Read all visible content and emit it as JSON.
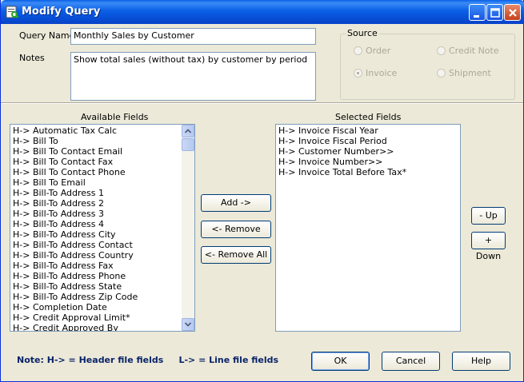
{
  "window": {
    "title": "Modify Query"
  },
  "query": {
    "name_label": "Query Name",
    "name_value": "Monthly Sales by Customer",
    "notes_label": "Notes",
    "notes_value": "Show total sales (without tax) by customer by period"
  },
  "source": {
    "title": "Source",
    "options": [
      {
        "label": "Order",
        "selected": false
      },
      {
        "label": "Credit Note",
        "selected": false
      },
      {
        "label": "Invoice",
        "selected": true
      },
      {
        "label": "Shipment",
        "selected": false
      }
    ]
  },
  "available_fields": {
    "label": "Available Fields",
    "items": [
      "H-> Automatic Tax Calc",
      "H-> Bill To",
      "H-> Bill To Contact Email",
      "H-> Bill To Contact Fax",
      "H-> Bill To Contact Phone",
      "H-> Bill To Email",
      "H-> Bill-To Address 1",
      "H-> Bill-To Address 2",
      "H-> Bill-To Address 3",
      "H-> Bill-To Address 4",
      "H-> Bill-To Address City",
      "H-> Bill-To Address Contact",
      "H-> Bill-To Address Country",
      "H-> Bill-To Address Fax",
      "H-> Bill-To Address Phone",
      "H-> Bill-To Address State",
      "H-> Bill-To Address Zip Code",
      "H-> Completion Date",
      "H-> Credit Approval Limit*",
      "H-> Credit Approved By"
    ]
  },
  "selected_fields": {
    "label": "Selected Fields",
    "items": [
      "H-> Invoice Fiscal Year",
      "H-> Invoice Fiscal Period",
      "H-> Customer Number>>",
      "H-> Invoice Number>>",
      "H-> Invoice Total Before Tax*"
    ]
  },
  "actions": {
    "add": "Add ->",
    "remove": "<- Remove",
    "remove_all": "<- Remove All",
    "up": "- Up",
    "down": "+ Down"
  },
  "footer": {
    "note_prefix": "Note:",
    "note_header": "H-> = Header file fields",
    "note_line": "L-> = Line file fields",
    "ok": "OK",
    "cancel": "Cancel",
    "help": "Help"
  }
}
